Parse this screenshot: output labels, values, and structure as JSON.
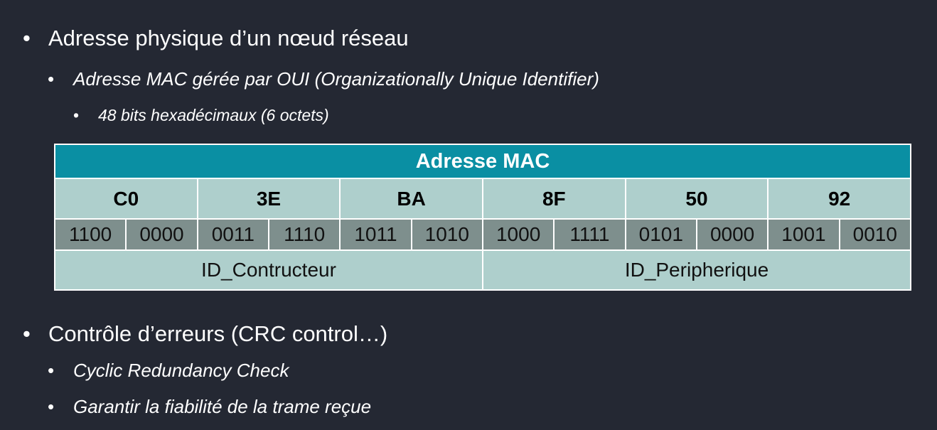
{
  "bullets": {
    "b1": "Adresse physique d’un nœud réseau",
    "b2": "Adresse MAC gérée par OUI (Organizationally Unique Identifier)",
    "b3": "48 bits hexadécimaux (6 octets)",
    "b4": "Contrôle d’erreurs (CRC control…)",
    "b5": "Cyclic Redundancy Check",
    "b6": "Garantir la fiabilité de la trame reçue"
  },
  "bullet_glyph": "•",
  "table": {
    "title": "Adresse MAC",
    "hex": [
      "C0",
      "3E",
      "BA",
      "8F",
      "50",
      "92"
    ],
    "bin": [
      "1100",
      "0000",
      "0011",
      "1110",
      "1011",
      "1010",
      "1000",
      "1111",
      "0101",
      "0000",
      "1001",
      "0010"
    ],
    "ids": [
      "ID_Contructeur",
      "ID_Peripherique"
    ]
  },
  "colors": {
    "background": "#242833",
    "header": "#0a8fa3",
    "light_cell": "#aecfcc",
    "dark_cell": "#7e8f8d"
  }
}
